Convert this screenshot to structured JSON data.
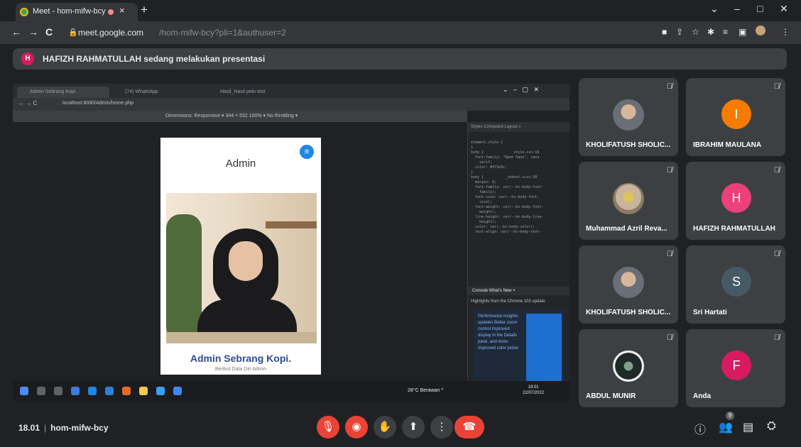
{
  "browser": {
    "tab_title": "Meet - hom-mifw-bcy",
    "tab_close": "×",
    "new_tab": "+",
    "window_controls": [
      "⌄",
      "–",
      "□",
      "✕"
    ],
    "nav": [
      "←",
      "→",
      "C"
    ],
    "url_host": "meet.google.com",
    "url_path": "/hom-mifw-bcy?pli=1&authuser=2",
    "toolbar_icons": [
      "camera-icon",
      "share-icon",
      "star-icon",
      "extensions-icon",
      "media-icon",
      "split-icon",
      "profile-icon",
      "kebab-icon"
    ]
  },
  "banner": {
    "avatar_letter": "H",
    "text": "HAFIZH RAHMATULLAH sedang melakukan presentasi",
    "avatar_color": "#d81b60"
  },
  "shared_screen": {
    "tabs": [
      "Admin Sebrang Kopi",
      "(74) WhatsApp",
      "Hasil_Hasil pelo test"
    ],
    "url": "localhost:8080/Admin/home.php",
    "device_toolbar": "Dimensions: Responsive ▾   344  ×  532    100% ▾   No throttling ▾",
    "page": {
      "heading": "Admin",
      "name": "Admin Sebrang Kopi.",
      "subtitle": "Berikut Data Diri Admin"
    },
    "devtools": {
      "tabs": "Styles  Computed  Layout  »",
      "code": "element.style {\n}\nbody {              style.css:16\n  font-family: \"Open Sans\", sans-\n    serif;\n  color: #373a3c;\n}\nbody {          _reboot.scss:38\n  margin: 0;\n  font-family: var(--bs-body-font-\n    family);\n  font-size: var(--bs-body-font-\n    size);\n  font-weight: var(--bs-body-font-\n    weight);\n  line-height: var(--bs-body-line-\n    height);\n  color: var(--bs-body-color);\n  text-align: var(--bs-body-text-",
      "whats_new_tab": "Console   What's New ×",
      "highlights": "Highlights from the Chrome 103 update",
      "card_text": "Performance insights updates Better zoom control Improved display in the Details pane, and more. Improved color picker"
    },
    "taskbar": {
      "weather": "28°C  Berawan  ^",
      "time": "19:01",
      "date": "22/07/2022"
    }
  },
  "participants": [
    {
      "name": "KHOLIFATUSH SHOLIC...",
      "type": "photo",
      "muted": true
    },
    {
      "name": "IBRAHIM MAULANA",
      "type": "initial",
      "letter": "I",
      "color": "#f57c00",
      "muted": true
    },
    {
      "name": "Muhammad Azril Reva...",
      "type": "photo",
      "muted": true
    },
    {
      "name": "HAFIZH RAHMATULLAH",
      "type": "initial",
      "letter": "H",
      "color": "#ec407a",
      "muted": true
    },
    {
      "name": "KHOLIFATUSH SHOLIC...",
      "type": "photo",
      "muted": true
    },
    {
      "name": "Sri Hartati",
      "type": "initial",
      "letter": "S",
      "color": "#455a64",
      "muted": true
    },
    {
      "name": "ABDUL MUNIR",
      "type": "photo",
      "muted": true
    },
    {
      "name": "Anda",
      "type": "initial",
      "letter": "F",
      "color": "#d81b60",
      "muted": true
    }
  ],
  "bottom_bar": {
    "time": "18.01",
    "meeting_code": "hom-mifw-bcy",
    "separator": "|",
    "controls": [
      "mic-off-icon",
      "camera-off-icon",
      "raise-hand-icon",
      "present-icon",
      "more-icon",
      "end-call-icon"
    ],
    "right_icons": [
      "info-icon",
      "people-icon",
      "chat-icon",
      "activities-icon"
    ],
    "people_badge": "9"
  }
}
